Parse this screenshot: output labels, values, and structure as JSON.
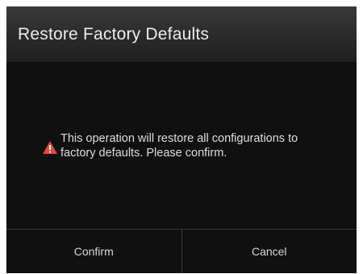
{
  "dialog": {
    "title": "Restore Factory Defaults",
    "message": "This operation will restore all configurations to factory defaults. Please confirm.",
    "icon": "warning-icon",
    "confirm_label": "Confirm",
    "cancel_label": "Cancel"
  },
  "colors": {
    "background": "#101010",
    "title_bar": "#2e2e2e",
    "warning": "#e8453c",
    "text": "#dedede"
  }
}
